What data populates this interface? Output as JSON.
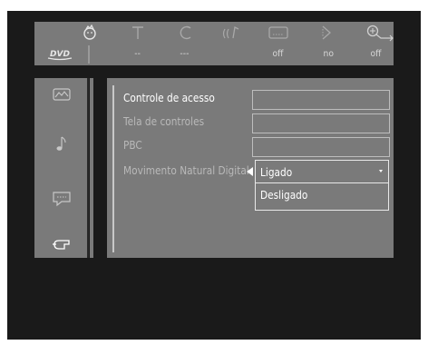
{
  "topbar": {
    "icons": [
      "user-icon",
      "title-icon",
      "chapter-icon",
      "audio-icon",
      "subtitle-icon",
      "angle-icon",
      "zoom-icon"
    ],
    "disc_badge": "DVD",
    "values": [
      "--",
      "---",
      "off",
      "no",
      "off"
    ]
  },
  "sidebar": {
    "icons": [
      "picture-icon",
      "sound-icon",
      "language-icon",
      "features-icon"
    ]
  },
  "menu": {
    "items": [
      {
        "label": "Controle de acesso",
        "active": true
      },
      {
        "label": "Tela de controles",
        "active": false
      },
      {
        "label": "PBC",
        "active": false
      },
      {
        "label": "Movimento Natural Digital",
        "active": false
      }
    ]
  },
  "dropdown": {
    "options": [
      "Ligado",
      "Desligado"
    ],
    "selected": "Ligado"
  }
}
